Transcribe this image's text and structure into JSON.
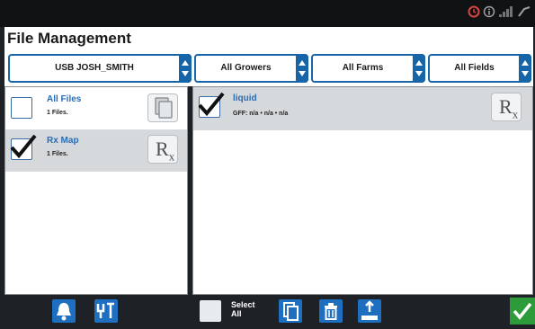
{
  "header": {
    "title": "File Management"
  },
  "filters": {
    "source": "USB JOSH_SMITH",
    "growers": "All Growers",
    "farms": "All Farms",
    "fields": "All Fields"
  },
  "file_types": [
    {
      "name": "All Files",
      "count": "1 Files.",
      "checked": false,
      "icon": "copy-files-icon"
    },
    {
      "name": "Rx Map",
      "count": "1 Files.",
      "checked": true,
      "icon": "rx-icon"
    }
  ],
  "prescriptions": [
    {
      "name": "liquid",
      "meta": "GFF:  n/a  •  n/a  •  n/a",
      "checked": true,
      "icon": "rx-icon"
    }
  ],
  "toolbar": {
    "select_all_label": "Select All"
  },
  "colors": {
    "accent": "#1565a8",
    "button_blue": "#1f6fc0",
    "ok_green": "#2e9b3a"
  }
}
